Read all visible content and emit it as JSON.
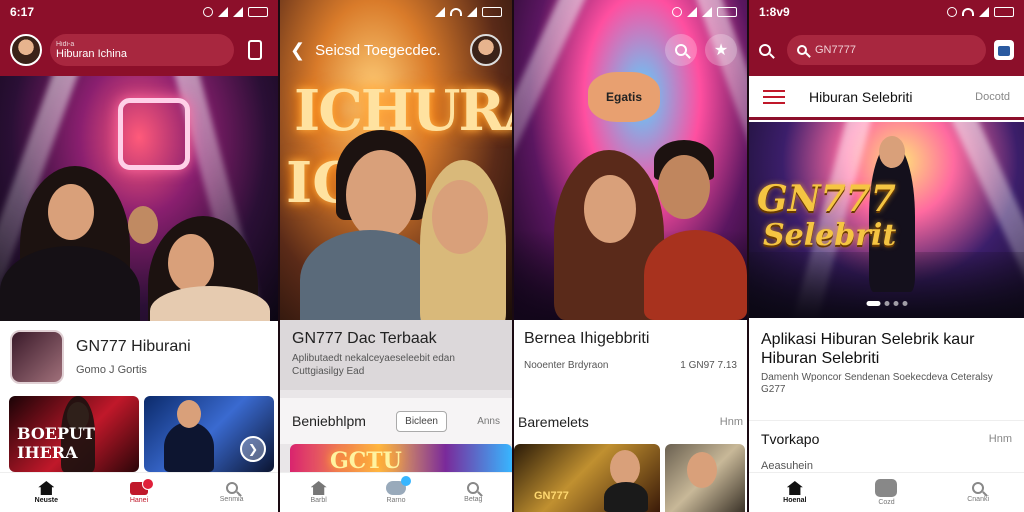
{
  "screen1": {
    "status_time": "6:17",
    "header": {
      "small_text": "Hidi-a",
      "name": "Hiburan Ichina"
    },
    "app": {
      "title": "GN777 Hiburani",
      "subtitle": "Gomo J Gortis"
    },
    "promo_text": "BOEPUT IHERA",
    "nav": [
      {
        "label": "Neuste",
        "icon": "home-icon"
      },
      {
        "label": "Hanei",
        "icon": "video-icon"
      },
      {
        "label": "Senmia",
        "icon": "search-icon"
      }
    ]
  },
  "screen2": {
    "header_title": "Seicsd Toegecdec.",
    "hero_neon": "ICHURA",
    "info": {
      "title": "GN777 Dac Terbaak",
      "subtitle": "Aplibutaedt nekalceyaeseleebit edan Cuttgiasilgy Ead"
    },
    "section": {
      "title": "Beniebhlpm",
      "chip": "Bicleen",
      "more": "Anns"
    },
    "nav": [
      {
        "label": "Barbl",
        "icon": "home-icon"
      },
      {
        "label": "Rarno",
        "icon": "cloud-icon"
      },
      {
        "label": "Betag",
        "icon": "search-icon"
      }
    ]
  },
  "screen3": {
    "bubble": "Egatis",
    "info": {
      "title": "Bernea Ihigebbriti",
      "meta_left": "Nooenter Brdyraon",
      "meta_right": "1 GN97 7.13"
    },
    "section": {
      "title": "Baremelets",
      "more": "Hnm"
    },
    "card_text": "GN777"
  },
  "screen4": {
    "status_time": "1:8v9",
    "search_value": "GN7777",
    "tabs": {
      "active": "Hiburan Selebriti",
      "other": "Docotd"
    },
    "hero_text_line1": "GN777",
    "hero_text_line2": "Selebrit",
    "info": {
      "title": "Aplikasi Hiburan Selebrik kaur Hiburan Selebriti",
      "subtitle": "Damenh Wponcor Sendenan Soekecdeva Ceteralsy G277"
    },
    "section": {
      "title": "Tvorkapo",
      "more": "Hnm"
    },
    "extra": "Aeasuhein",
    "nav": [
      {
        "label": "Hoenal",
        "icon": "home-icon"
      },
      {
        "label": "Cozd",
        "icon": "square-icon"
      },
      {
        "label": "Cnanki",
        "icon": "search-icon"
      }
    ]
  }
}
